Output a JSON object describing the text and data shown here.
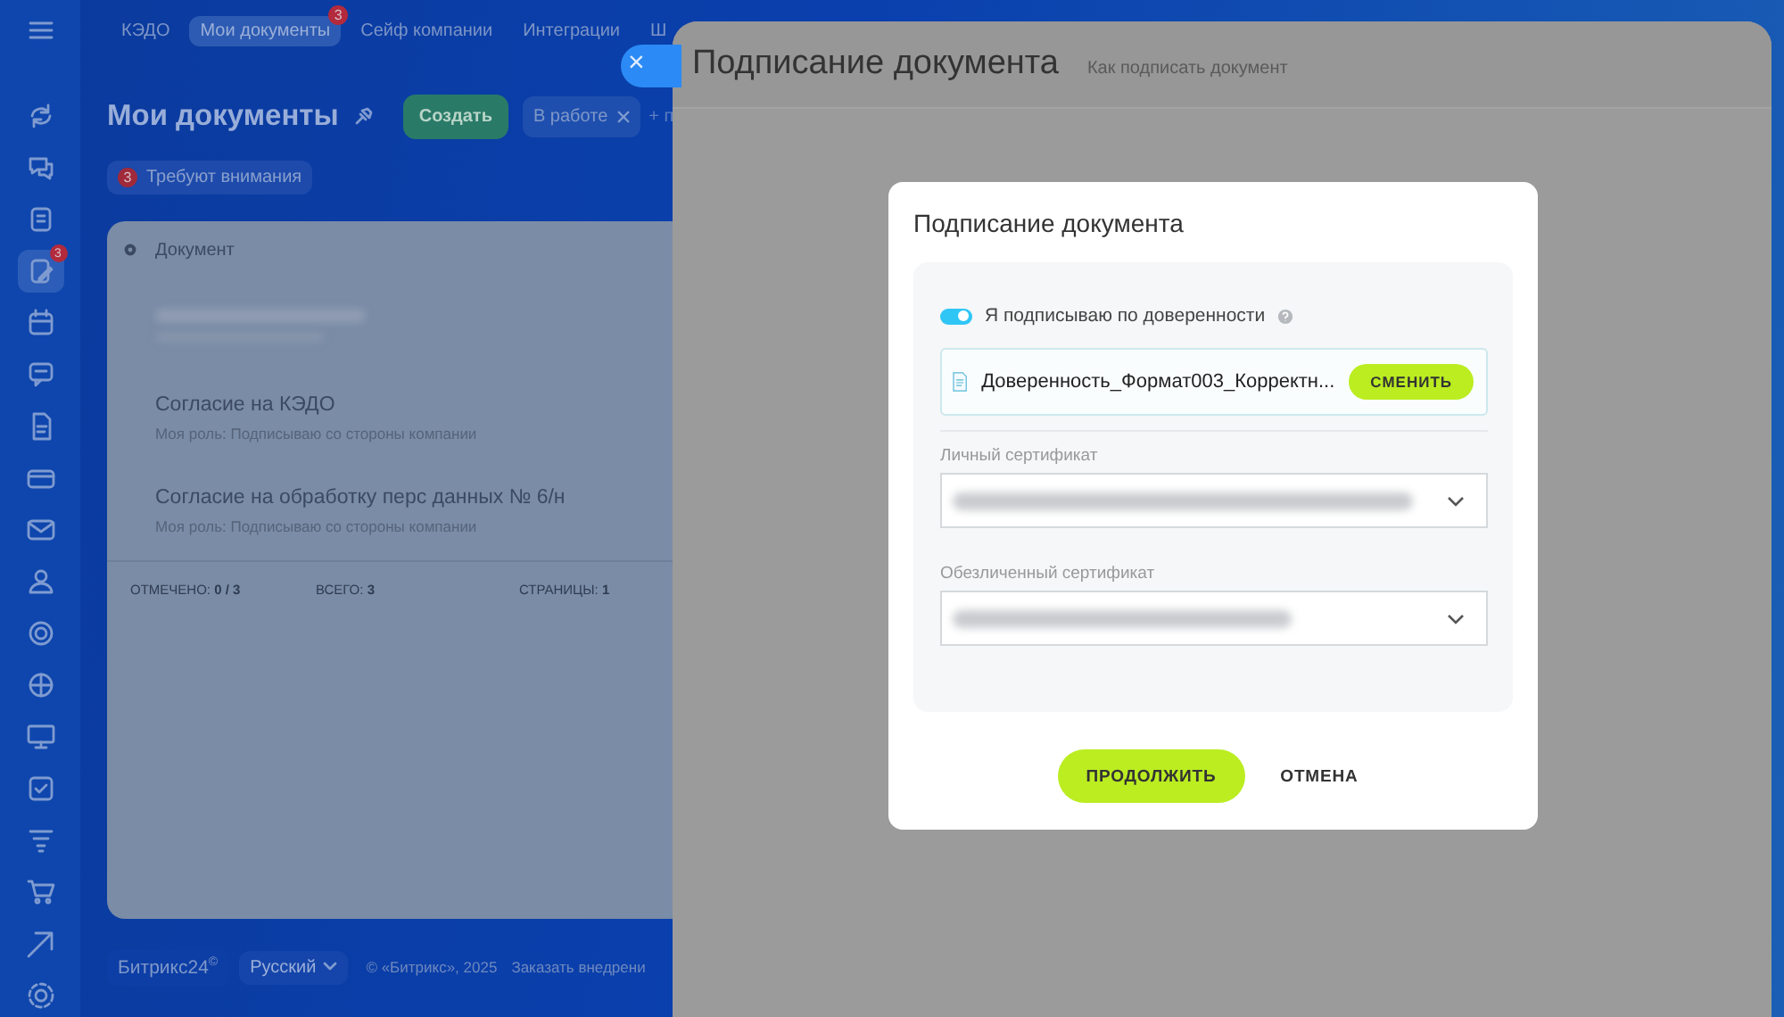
{
  "sidebar": {
    "items": [
      {
        "selected": false
      },
      {
        "selected": false
      },
      {
        "selected": false
      },
      {
        "selected": true,
        "badge": "3"
      },
      {
        "selected": false
      },
      {
        "selected": false
      },
      {
        "selected": false
      },
      {
        "selected": false
      },
      {
        "selected": false
      },
      {
        "selected": false
      },
      {
        "selected": false
      },
      {
        "selected": false
      },
      {
        "selected": false
      },
      {
        "selected": false
      },
      {
        "selected": false
      },
      {
        "selected": false
      },
      {
        "selected": false
      },
      {
        "selected": false
      }
    ]
  },
  "top_nav": {
    "tabs": [
      {
        "label": "КЭДО",
        "selected": false
      },
      {
        "label": "Мои документы",
        "selected": true,
        "badge": "3"
      },
      {
        "label": "Сейф компании",
        "selected": false
      },
      {
        "label": "Интеграции",
        "selected": false
      },
      {
        "label": "Ш",
        "selected": false
      }
    ]
  },
  "page": {
    "title": "Мои документы",
    "create_button": "Создать",
    "filter_chip": "В работе",
    "filter_more": "+ п",
    "attention": {
      "count": "3",
      "label": "Требуют внимания"
    }
  },
  "table": {
    "column": "Документ",
    "rows": [
      {
        "blurred": true
      },
      {
        "title": "Согласие на КЭДО",
        "role": "Моя роль: Подписываю со стороны компании"
      },
      {
        "title": "Согласие на обработку перс данных № 6/н",
        "role": "Моя роль: Подписываю со стороны компании"
      }
    ],
    "footer": {
      "checked_label": "ОТМЕЧЕНО:",
      "checked_value": "0 / 3",
      "total_label": "ВСЕГО:",
      "total_value": "3",
      "pages_label": "СТРАНИЦЫ:",
      "pages_value": "1"
    }
  },
  "footer": {
    "brand": "Битрикс24$^{©}$",
    "language": "Русский",
    "copyright": "© «Битрикс», 2025",
    "order_link": "Заказать внедрени"
  },
  "slider": {
    "title": "Подписание документа",
    "help_link": "Как подписать документ",
    "close": "×"
  },
  "dialog": {
    "title": "Подписание документа",
    "proxy_toggle": {
      "label": "Я подписываю по доверенности",
      "on": true
    },
    "file": {
      "name": "Доверенность_Формат003_Корректн...",
      "button": "СМЕНИТЬ"
    },
    "fields": [
      {
        "label": "Личный сертификат",
        "blurred": true
      },
      {
        "label": "Обезличенный сертификат",
        "blurred": true
      }
    ],
    "buttons": {
      "continue": "ПРОДОЛЖИТЬ",
      "cancel": "ОТМЕНА"
    }
  }
}
